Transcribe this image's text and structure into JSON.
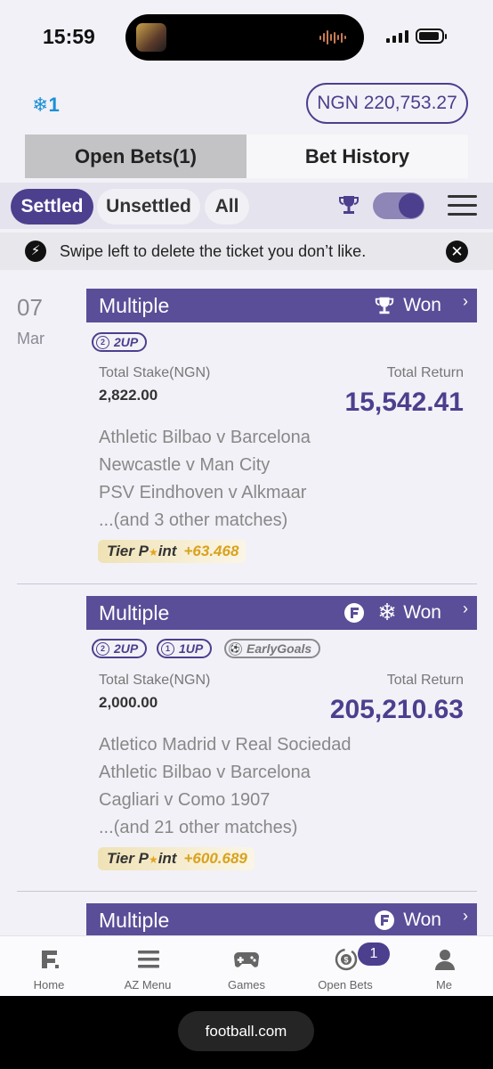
{
  "status_bar": {
    "time": "15:59"
  },
  "header": {
    "freeze_count": "1",
    "freeze_icon": "❄",
    "balance": "NGN 220,753.27"
  },
  "tabs": [
    {
      "label": "Open Bets(1)"
    },
    {
      "label": "Bet History"
    }
  ],
  "filters": {
    "settled": "Settled",
    "unsettled": "Unsettled",
    "all": "All"
  },
  "notice": {
    "text": "Swipe left to delete the ticket you don’t like."
  },
  "date": {
    "day": "07",
    "month": "Mar"
  },
  "bets": [
    {
      "type": "Multiple",
      "status": "Won",
      "icons": [
        "trophy-icon"
      ],
      "badges": [
        "2UP"
      ],
      "stake_label": "Total Stake(NGN)",
      "stake": "2,822.00",
      "return_label": "Total Return",
      "return": "15,542.41",
      "matches": [
        "Athletic Bilbao v Barcelona",
        "Newcastle v Man City",
        "PSV Eindhoven v Alkmaar",
        "...(and 3 other matches)"
      ],
      "tier_label": "Tier Point",
      "tier_points": "+63.468"
    },
    {
      "type": "Multiple",
      "status": "Won",
      "icons": [
        "football-logo-icon",
        "snowflake-icon"
      ],
      "badges": [
        "2UP",
        "1UP",
        "EarlyGoals"
      ],
      "stake_label": "Total Stake(NGN)",
      "stake": "2,000.00",
      "return_label": "Total Return",
      "return": "205,210.63",
      "matches": [
        "Atletico Madrid v Real Sociedad",
        "Athletic Bilbao v Barcelona",
        "Cagliari v Como 1907",
        "...(and 21 other matches)"
      ],
      "tier_label": "Tier Point",
      "tier_points": "+600.689"
    },
    {
      "type": "Multiple",
      "status": "Won",
      "icons": [
        "football-logo-icon"
      ]
    }
  ],
  "tab_bar": [
    {
      "label": "Home",
      "icon": "home-logo-icon"
    },
    {
      "label": "AZ Menu",
      "icon": "menu-icon"
    },
    {
      "label": "Games",
      "icon": "gamepad-icon"
    },
    {
      "label": "Open Bets",
      "icon": "open-bets-icon",
      "badge": "1"
    },
    {
      "label": "Me",
      "icon": "person-icon"
    }
  ],
  "browser": {
    "url": "football.com"
  },
  "colors": {
    "brand": "#4c3f8e",
    "card_header": "#5b4e98",
    "tier_gold": "#d9a21e",
    "freeze_blue": "#1c8fd6"
  }
}
